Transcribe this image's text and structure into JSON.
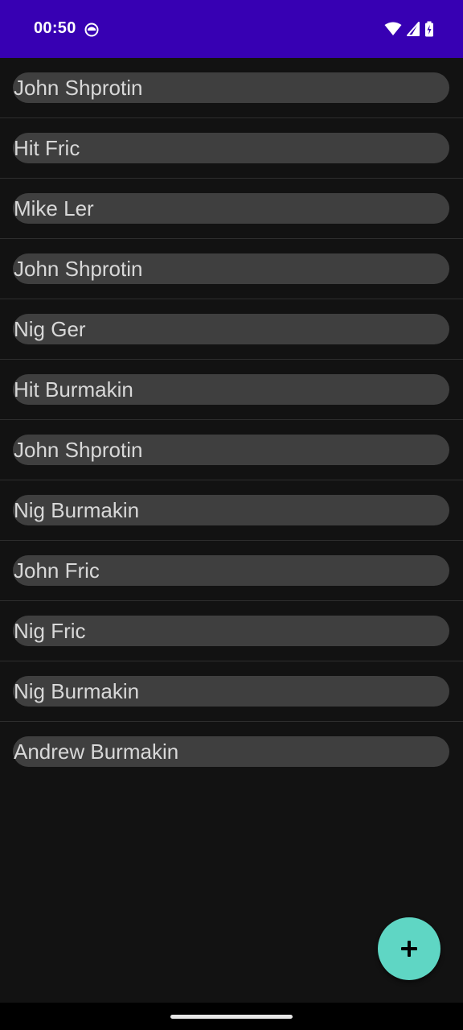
{
  "status_bar": {
    "time": "00:50",
    "notification_icon": "app-notification-icon",
    "icons": [
      "wifi-icon",
      "cellular-signal-icon",
      "battery-charging-icon"
    ],
    "background_color": "#3700b3"
  },
  "list": {
    "items": [
      {
        "label": "John Shprotin"
      },
      {
        "label": "Hit Fric"
      },
      {
        "label": "Mike Ler"
      },
      {
        "label": "John Shprotin"
      },
      {
        "label": "Nig Ger"
      },
      {
        "label": "Hit Burmakin"
      },
      {
        "label": "John Shprotin"
      },
      {
        "label": "Nig Burmakin"
      },
      {
        "label": "John Fric"
      },
      {
        "label": "Nig Fric"
      },
      {
        "label": "Nig Burmakin"
      },
      {
        "label": "Andrew Burmakin"
      }
    ]
  },
  "fab": {
    "icon": "plus-icon",
    "color": "#5fd6c4"
  },
  "nav_bar": {
    "handle": "gesture-handle"
  }
}
